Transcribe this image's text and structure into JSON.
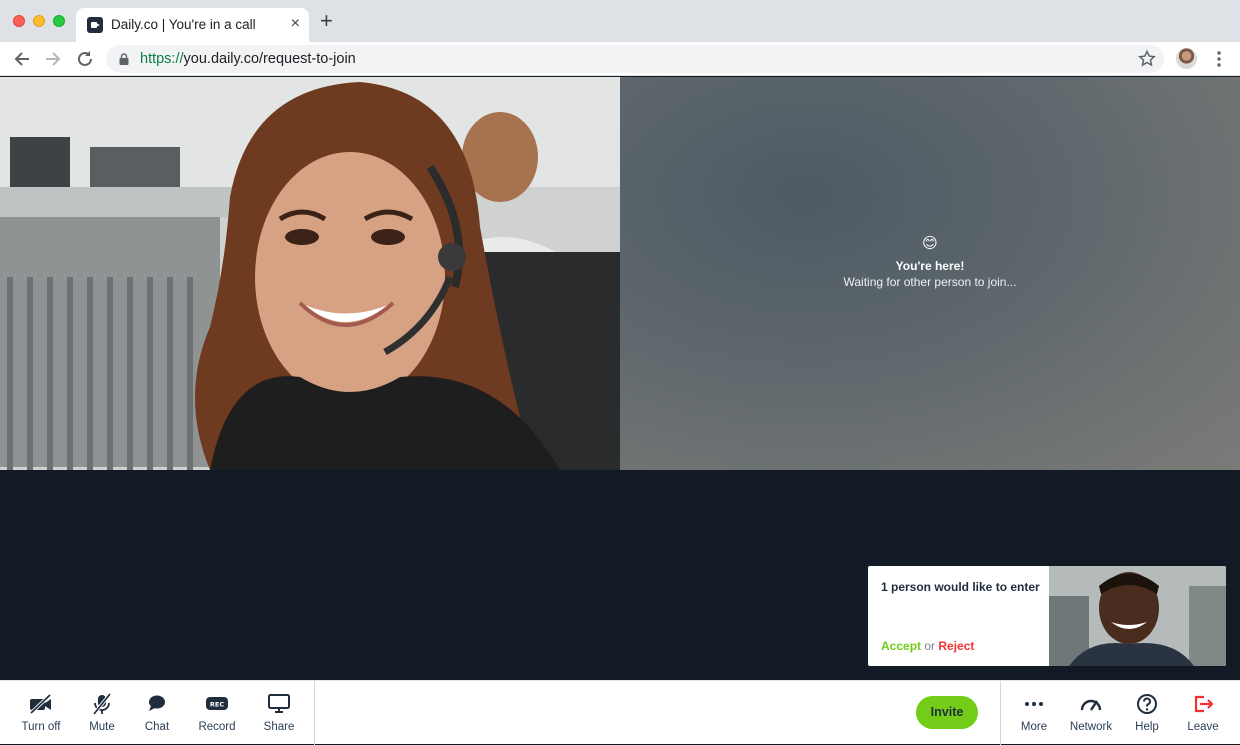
{
  "browser": {
    "tab_title": "Daily.co | You're in a call",
    "tab_close": "×",
    "new_tab": "+",
    "url_scheme": "https://",
    "url_rest": "you.daily.co/request-to-join"
  },
  "call": {
    "self_status_emoji": "😊",
    "self_status_title": "You're here!",
    "self_status_subtitle": "Waiting for other person to join..."
  },
  "knock": {
    "message": "1 person would like to enter",
    "accept_label": "Accept",
    "or_label": "or",
    "reject_label": "Reject"
  },
  "tray": {
    "left": [
      {
        "label": "Turn off",
        "icon": "camera-off-icon"
      },
      {
        "label": "Mute",
        "icon": "mic-off-icon"
      },
      {
        "label": "Chat",
        "icon": "chat-icon"
      },
      {
        "label": "Record",
        "icon": "record-icon"
      },
      {
        "label": "Share",
        "icon": "screen-share-icon"
      }
    ],
    "invite_label": "Invite",
    "right": [
      {
        "label": "More",
        "icon": "more-icon"
      },
      {
        "label": "Network",
        "icon": "network-icon"
      },
      {
        "label": "Help",
        "icon": "help-icon"
      },
      {
        "label": "Leave",
        "icon": "leave-icon"
      }
    ]
  },
  "colors": {
    "accent_green": "#72cc18",
    "reject_red": "#f63135",
    "tray_text": "#2b3f56",
    "stage_bg": "#121a26"
  }
}
